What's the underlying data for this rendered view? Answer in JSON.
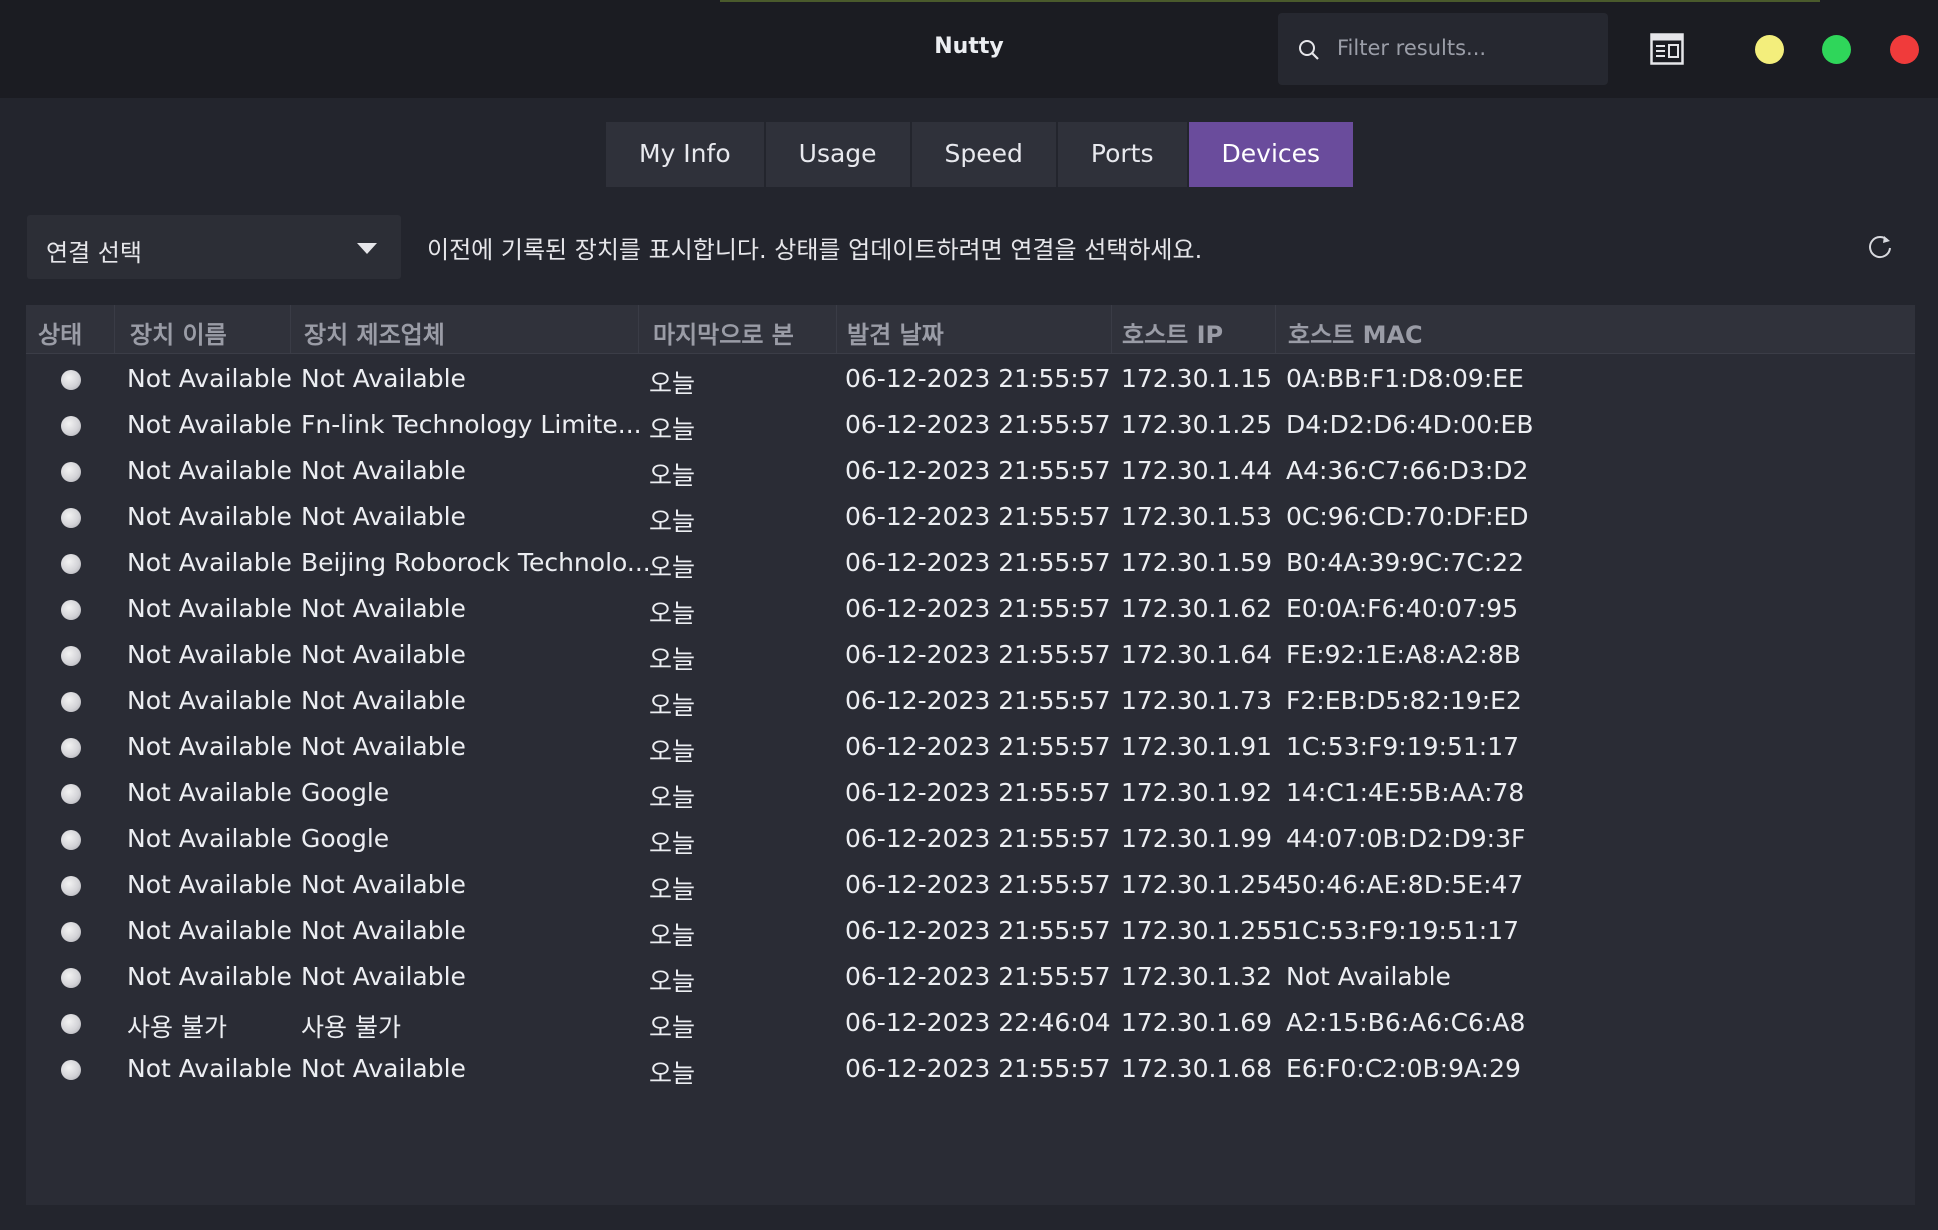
{
  "window": {
    "title": "Nutty",
    "search_placeholder": "Filter results...",
    "controls": {
      "layout_icon": "layout-icon",
      "minimize_color": "#f3ee7c",
      "maximize_color": "#2fd65a",
      "close_color": "#f03b3b"
    }
  },
  "tabs": [
    {
      "label": "My Info"
    },
    {
      "label": "Usage"
    },
    {
      "label": "Speed"
    },
    {
      "label": "Ports"
    },
    {
      "label": "Devices",
      "active": true
    }
  ],
  "accent_color": "#6a4c9c",
  "connection": {
    "selected": "연결 선택"
  },
  "description": "이전에 기록된 장치를 표시합니다. 상태를 업데이트하려면 연결을 선택하세요.",
  "table": {
    "headers": [
      "상태",
      "장치 이름",
      "장치 제조업체",
      "마지막으로 본",
      "발견 날짜",
      "호스트 IP",
      "호스트 MAC"
    ],
    "rows": [
      {
        "name": "Not Available",
        "vendor": "Not Available",
        "last_seen": "오늘",
        "discovered": "06-12-2023 21:55:57",
        "ip": "172.30.1.15",
        "mac": "0A:BB:F1:D8:09:EE"
      },
      {
        "name": "Not Available",
        "vendor": "Fn-link Technology Limite...",
        "last_seen": "오늘",
        "discovered": "06-12-2023 21:55:57",
        "ip": "172.30.1.25",
        "mac": "D4:D2:D6:4D:00:EB"
      },
      {
        "name": "Not Available",
        "vendor": "Not Available",
        "last_seen": "오늘",
        "discovered": "06-12-2023 21:55:57",
        "ip": "172.30.1.44",
        "mac": "A4:36:C7:66:D3:D2"
      },
      {
        "name": "Not Available",
        "vendor": "Not Available",
        "last_seen": "오늘",
        "discovered": "06-12-2023 21:55:57",
        "ip": "172.30.1.53",
        "mac": "0C:96:CD:70:DF:ED"
      },
      {
        "name": "Not Available",
        "vendor": "Beijing Roborock Technolo...",
        "last_seen": "오늘",
        "discovered": "06-12-2023 21:55:57",
        "ip": "172.30.1.59",
        "mac": "B0:4A:39:9C:7C:22"
      },
      {
        "name": "Not Available",
        "vendor": "Not Available",
        "last_seen": "오늘",
        "discovered": "06-12-2023 21:55:57",
        "ip": "172.30.1.62",
        "mac": "E0:0A:F6:40:07:95"
      },
      {
        "name": "Not Available",
        "vendor": "Not Available",
        "last_seen": "오늘",
        "discovered": "06-12-2023 21:55:57",
        "ip": "172.30.1.64",
        "mac": "FE:92:1E:A8:A2:8B"
      },
      {
        "name": "Not Available",
        "vendor": "Not Available",
        "last_seen": "오늘",
        "discovered": "06-12-2023 21:55:57",
        "ip": "172.30.1.73",
        "mac": "F2:EB:D5:82:19:E2"
      },
      {
        "name": "Not Available",
        "vendor": "Not Available",
        "last_seen": "오늘",
        "discovered": "06-12-2023 21:55:57",
        "ip": "172.30.1.91",
        "mac": "1C:53:F9:19:51:17"
      },
      {
        "name": "Not Available",
        "vendor": "Google",
        "last_seen": "오늘",
        "discovered": "06-12-2023 21:55:57",
        "ip": "172.30.1.92",
        "mac": "14:C1:4E:5B:AA:78"
      },
      {
        "name": "Not Available",
        "vendor": "Google",
        "last_seen": "오늘",
        "discovered": "06-12-2023 21:55:57",
        "ip": "172.30.1.99",
        "mac": "44:07:0B:D2:D9:3F"
      },
      {
        "name": "Not Available",
        "vendor": "Not Available",
        "last_seen": "오늘",
        "discovered": "06-12-2023 21:55:57",
        "ip": "172.30.1.254",
        "mac": "50:46:AE:8D:5E:47"
      },
      {
        "name": "Not Available",
        "vendor": "Not Available",
        "last_seen": "오늘",
        "discovered": "06-12-2023 21:55:57",
        "ip": "172.30.1.255",
        "mac": "1C:53:F9:19:51:17"
      },
      {
        "name": "Not Available",
        "vendor": "Not Available",
        "last_seen": "오늘",
        "discovered": "06-12-2023 21:55:57",
        "ip": "172.30.1.32",
        "mac": "Not Available"
      },
      {
        "name": "사용 불가",
        "vendor": "사용 불가",
        "last_seen": "오늘",
        "discovered": "06-12-2023 22:46:04",
        "ip": "172.30.1.69",
        "mac": "A2:15:B6:A6:C6:A8"
      },
      {
        "name": "Not Available",
        "vendor": "Not Available",
        "last_seen": "오늘",
        "discovered": "06-12-2023 21:55:57",
        "ip": "172.30.1.68",
        "mac": "E6:F0:C2:0B:9A:29"
      }
    ]
  }
}
